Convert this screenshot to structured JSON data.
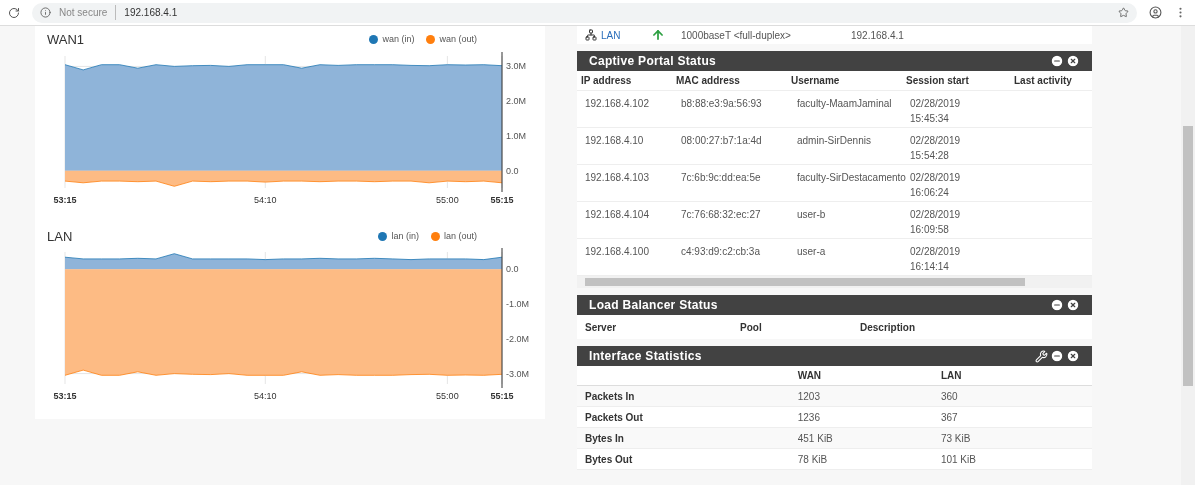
{
  "browser": {
    "security": "Not secure",
    "url": "192.168.4.1"
  },
  "traffic_graphs": [
    {
      "title": "WAN1",
      "chart_data": {
        "type": "area",
        "grid": true,
        "categories": [
          "53:15",
          null,
          null,
          null,
          null,
          null,
          null,
          null,
          null,
          null,
          null,
          "54:10",
          null,
          null,
          null,
          null,
          null,
          null,
          null,
          null,
          null,
          "55:00",
          null,
          null,
          "55:15"
        ],
        "ylim": [
          -0.5,
          3.3
        ],
        "yticks": [
          {
            "value": 0,
            "label": "0.0"
          },
          {
            "value": 1,
            "label": "1.0M"
          },
          {
            "value": 2,
            "label": "2.0M"
          },
          {
            "value": 3,
            "label": "3.0M"
          }
        ],
        "series": [
          {
            "name": "wan (in)",
            "color": "#1f77b4",
            "values": [
              3.05,
              2.9,
              3.05,
              3.05,
              2.95,
              3.05,
              3.0,
              3.02,
              3.03,
              3.0,
              3.05,
              3.05,
              3.05,
              2.95,
              3.05,
              3.03,
              3.05,
              3.05,
              3.05,
              3.03,
              3.02,
              3.05,
              3.04,
              3.05,
              3.02
            ]
          },
          {
            "name": "wan (out)",
            "color": "#ff7f0e",
            "values": [
              -0.3,
              -0.35,
              -0.3,
              -0.3,
              -0.32,
              -0.3,
              -0.45,
              -0.3,
              -0.32,
              -0.3,
              -0.3,
              -0.33,
              -0.3,
              -0.3,
              -0.32,
              -0.3,
              -0.3,
              -0.32,
              -0.3,
              -0.3,
              -0.35,
              -0.3,
              -0.32,
              -0.3,
              -0.35
            ]
          }
        ]
      }
    },
    {
      "title": "LAN",
      "chart_data": {
        "type": "area",
        "grid": true,
        "categories": [
          "53:15",
          null,
          null,
          null,
          null,
          null,
          null,
          null,
          null,
          null,
          null,
          "54:10",
          null,
          null,
          null,
          null,
          null,
          null,
          null,
          null,
          null,
          "55:00",
          null,
          null,
          "55:15"
        ],
        "ylim": [
          -3.3,
          0.5
        ],
        "yticks": [
          {
            "value": 0,
            "label": "0.0"
          },
          {
            "value": -1,
            "label": "-1.0M"
          },
          {
            "value": -2,
            "label": "-2.0M"
          },
          {
            "value": -3,
            "label": "-3.0M"
          }
        ],
        "series": [
          {
            "name": "lan (in)",
            "color": "#1f77b4",
            "values": [
              0.35,
              0.3,
              0.3,
              0.3,
              0.32,
              0.3,
              0.45,
              0.3,
              0.3,
              0.3,
              0.3,
              0.28,
              0.3,
              0.3,
              0.32,
              0.3,
              0.3,
              0.32,
              0.3,
              0.28,
              0.3,
              0.3,
              0.3,
              0.28,
              0.35
            ]
          },
          {
            "name": "lan (out)",
            "color": "#ff7f0e",
            "values": [
              -3.05,
              -2.9,
              -3.05,
              -3.05,
              -2.95,
              -3.05,
              -3.0,
              -3.02,
              -3.03,
              -3.0,
              -3.05,
              -3.05,
              -3.05,
              -2.95,
              -3.05,
              -3.03,
              -3.05,
              -3.05,
              -3.05,
              -3.03,
              -3.02,
              -3.05,
              -3.04,
              -3.05,
              -3.02
            ]
          }
        ]
      }
    }
  ],
  "interfaces": [
    {
      "name": "LAN",
      "up": true,
      "media": "1000baseT <full-duplex>",
      "address": "192.168.4.1"
    }
  ],
  "captive_portal": {
    "title": "Captive Portal Status",
    "columns": [
      "IP address",
      "MAC address",
      "Username",
      "Session start",
      "Last activity"
    ],
    "rows": [
      [
        "192.168.4.102",
        "b8:88:e3:9a:56:93",
        "faculty-MaamJaminal",
        "02/28/2019 15:45:34"
      ],
      [
        "192.168.4.10",
        "08:00:27:b7:1a:4d",
        "admin-SirDennis",
        "02/28/2019 15:54:28"
      ],
      [
        "192.168.4.103",
        "7c:6b:9c:dd:ea:5e",
        "faculty-SirDestacamento",
        "02/28/2019 16:06:24"
      ],
      [
        "192.168.4.104",
        "7c:76:68:32:ec:27",
        "user-b",
        "02/28/2019 16:09:58"
      ],
      [
        "192.168.4.100",
        "c4:93:d9:c2:cb:3a",
        "user-a",
        "02/28/2019 16:14:14"
      ]
    ]
  },
  "load_balancer": {
    "title": "Load Balancer Status",
    "columns": [
      "Server",
      "Pool",
      "Description"
    ]
  },
  "interface_statistics": {
    "title": "Interface Statistics",
    "columns": [
      "WAN",
      "LAN"
    ],
    "rows": [
      {
        "label": "Packets In",
        "values": [
          "1203",
          "360"
        ]
      },
      {
        "label": "Packets Out",
        "values": [
          "1236",
          "367"
        ]
      },
      {
        "label": "Bytes In",
        "values": [
          "451 KiB",
          "73 KiB"
        ]
      },
      {
        "label": "Bytes Out",
        "values": [
          "78 KiB",
          "101 KiB"
        ]
      }
    ]
  }
}
